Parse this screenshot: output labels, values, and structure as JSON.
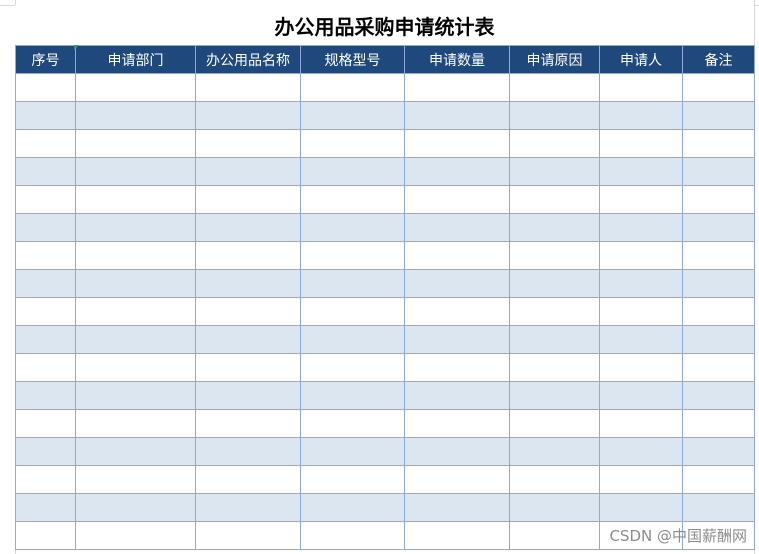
{
  "title": "办公用品采购申请统计表",
  "headers": [
    "序号",
    "申请部门",
    "办公用品名称",
    "规格型号",
    "申请数量",
    "申请原因",
    "申请人",
    "备注"
  ],
  "row_count": 17,
  "colors": {
    "header_bg": "#1f497d",
    "header_text": "#ffffff",
    "band": "#dce6f1",
    "border": "#8ea9db"
  },
  "watermark": "CSDN @中国薪酬网"
}
